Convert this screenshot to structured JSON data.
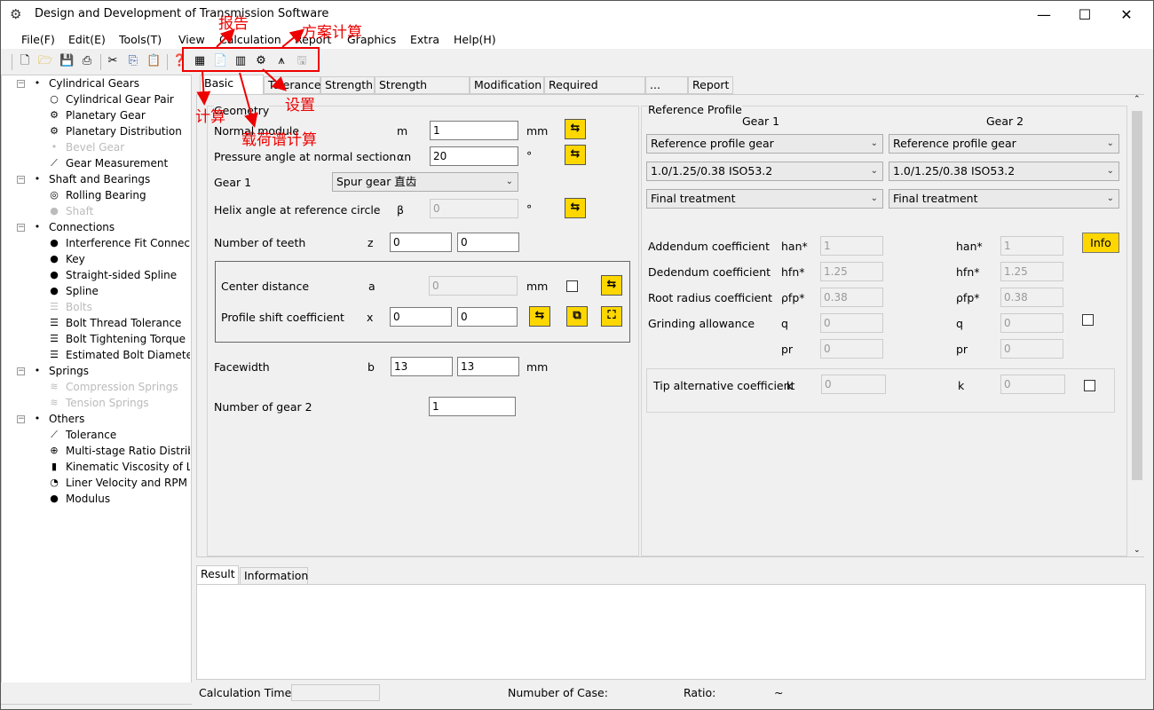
{
  "window": {
    "title": "Design and Development of Transmission Software",
    "minimize": "—",
    "maximize": "☐",
    "close": "✕"
  },
  "menu": [
    "File(F)",
    "Edit(E)",
    "Tools(T)",
    "View",
    "Calculation",
    "Report",
    "Graphics",
    "Extra",
    "Help(H)"
  ],
  "tree": {
    "groups": [
      {
        "label": "Cylindrical Gears",
        "items": [
          {
            "label": "Cylindrical Gear Pair",
            "icon": "gear-pair-icon",
            "dim": false
          },
          {
            "label": "Planetary Gear",
            "icon": "planetary-gear-icon",
            "dim": false
          },
          {
            "label": "Planetary Distribution",
            "icon": "planetary-distribution-icon",
            "dim": false
          },
          {
            "label": "Bevel Gear",
            "icon": "bevel-gear-icon",
            "dim": true
          },
          {
            "label": "Gear Measurement",
            "icon": "measurement-icon",
            "dim": false
          }
        ]
      },
      {
        "label": "Shaft and Bearings",
        "items": [
          {
            "label": "Rolling Bearing",
            "icon": "bearing-icon",
            "dim": false
          },
          {
            "label": "Shaft",
            "icon": "shaft-icon",
            "dim": true
          }
        ]
      },
      {
        "label": "Connections",
        "items": [
          {
            "label": "Interference Fit Connection",
            "icon": "interference-fit-icon",
            "dim": false
          },
          {
            "label": "Key",
            "icon": "key-icon",
            "dim": false
          },
          {
            "label": "Straight-sided Spline",
            "icon": "spline-icon",
            "dim": false
          },
          {
            "label": "Spline",
            "icon": "spline-icon",
            "dim": false
          },
          {
            "label": "Bolts",
            "icon": "bolt-icon",
            "dim": true
          },
          {
            "label": "Bolt Thread Tolerance",
            "icon": "bolt-icon",
            "dim": false
          },
          {
            "label": "Bolt Tightening Torque",
            "icon": "bolt-icon",
            "dim": false
          },
          {
            "label": "Estimated Bolt Diameter",
            "icon": "bolt-icon",
            "dim": false
          }
        ]
      },
      {
        "label": "Springs",
        "items": [
          {
            "label": "Compression Springs",
            "icon": "spring-icon",
            "dim": true
          },
          {
            "label": "Tension Springs",
            "icon": "spring-icon",
            "dim": true
          }
        ]
      },
      {
        "label": "Others",
        "items": [
          {
            "label": "Tolerance",
            "icon": "ruler-icon",
            "dim": false
          },
          {
            "label": "Multi-stage Ratio Distribution",
            "icon": "ratio-icon",
            "dim": false
          },
          {
            "label": "Kinematic Viscosity of Lubricant",
            "icon": "oil-icon",
            "dim": false
          },
          {
            "label": "Liner Velocity and RPM",
            "icon": "gauge-icon",
            "dim": false
          },
          {
            "label": "Modulus",
            "icon": "modulus-icon",
            "dim": false
          }
        ]
      }
    ]
  },
  "tabs": [
    "Basic data",
    "Tolerance",
    "Strength",
    "Strength factors",
    "Modification",
    "Required safeties",
    "...",
    "Report"
  ],
  "geometry": {
    "title": "Geometry",
    "normal_module": {
      "label": "Normal module",
      "symbol": "m",
      "value": "1",
      "unit": "mm"
    },
    "pressure_angle": {
      "label": "Pressure angle at normal section",
      "symbol": "αn",
      "value": "20",
      "unit": "°"
    },
    "gear1": {
      "label": "Gear 1",
      "value": "Spur gear 直齿"
    },
    "helix_angle": {
      "label": "Helix angle at reference circle",
      "symbol": "β",
      "value": "0",
      "unit": "°"
    },
    "teeth": {
      "label": "Number of teeth",
      "symbol": "z",
      "value1": "0",
      "value2": "0"
    },
    "center_distance": {
      "label": "Center distance",
      "symbol": "a",
      "value": "0",
      "unit": "mm"
    },
    "profile_shift": {
      "label": "Profile shift coefficient",
      "symbol": "x",
      "value1": "0",
      "value2": "0"
    },
    "facewidth": {
      "label": "Facewidth",
      "symbol": "b",
      "value1": "13",
      "value2": "13",
      "unit": "mm"
    },
    "gear2_count": {
      "label": "Number of gear 2",
      "value": "1"
    }
  },
  "reference_profile": {
    "title": "Reference Profile",
    "gear1_header": "Gear 1",
    "gear2_header": "Gear 2",
    "gear1_selects": [
      "Reference profile gear",
      "1.0/1.25/0.38 ISO53.2",
      "Final treatment"
    ],
    "gear2_selects": [
      "Reference profile gear",
      "1.0/1.25/0.38 ISO53.2",
      "Final treatment"
    ],
    "rows": [
      {
        "label": "Addendum coefficient",
        "sym": "han*",
        "v1": "1",
        "v2": "1"
      },
      {
        "label": "Dedendum coefficient",
        "sym": "hfn*",
        "v1": "1.25",
        "v2": "1.25"
      },
      {
        "label": "Root radius coefficient",
        "sym": "ρfp*",
        "v1": "0.38",
        "v2": "0.38"
      },
      {
        "label": "Grinding allowance",
        "sym": "q",
        "v1": "0",
        "v2": "0"
      },
      {
        "label": "",
        "sym": "pr",
        "v1": "0",
        "v2": "0"
      }
    ],
    "info_button": "Info",
    "tip_alt": {
      "label": "Tip alternative coefficient",
      "sym1": "k",
      "v1": "0",
      "sym2": "k",
      "v2": "0"
    }
  },
  "bottom_tabs": [
    "Result",
    "Information"
  ],
  "status": {
    "calc_time_label": "Calculation Time:",
    "case_label": "Numuber of Case:",
    "ratio_label": "Ratio:",
    "ratio_value": "~"
  },
  "annotations": {
    "report": "报告",
    "scheme": "方案计算",
    "calc": "计算",
    "settings": "设置",
    "load_spectrum": "载荷谱计算"
  },
  "colors": {
    "accent_yellow": "#ffd700",
    "annotation_red": "#ee0000"
  }
}
